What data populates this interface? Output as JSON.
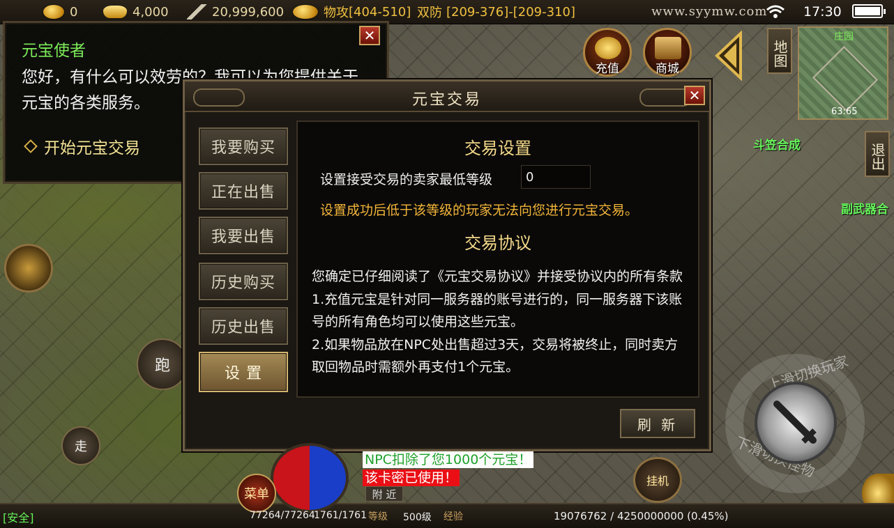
{
  "topbar": {
    "gold": "0",
    "ingot": "4,000",
    "currency3": "20,999,600",
    "attack_label": "物攻",
    "attack_value": "[404-510]",
    "defense_label": "双防",
    "defense_value": "[209-376]-[209-310]",
    "watermark": "www.syymw.com",
    "time": "17:30"
  },
  "npc_dialog": {
    "title": "元宝使者",
    "text": "您好，有什么可以效劳的？我可以为您提供关于元宝的各类服务。",
    "link": "开始元宝交易",
    "close": "✕"
  },
  "right_buttons": {
    "recharge": "充值",
    "shop": "商城",
    "map": "地图",
    "exit": "退出"
  },
  "minimap": {
    "title": "庄园",
    "coords": "63:65"
  },
  "map_labels": {
    "npc1": "斗笠合成",
    "npc2": "副武器合"
  },
  "left_controls": {
    "run": "跑",
    "walk": "走"
  },
  "trade_panel": {
    "title": "元宝交易",
    "close": "✕",
    "tabs": [
      {
        "label": "我要购买"
      },
      {
        "label": "正在出售"
      },
      {
        "label": "我要出售"
      },
      {
        "label": "历史购买"
      },
      {
        "label": "历史出售"
      },
      {
        "label": "设 置"
      }
    ],
    "settings_heading": "交易设置",
    "min_level_label": "设置接受交易的卖家最低等级",
    "min_level_value": "0",
    "warning": "设置成功后低于该等级的玩家无法向您进行元宝交易。",
    "agreement_heading": "交易协议",
    "agreement_text": "您确定已仔细阅读了《元宝交易协议》并接受协议内的所有条款",
    "rule1": "1.充值元宝是针对同一服务器的账号进行的，同一服务器下该账号的所有角色均可以使用这些元宝。",
    "rule2": "2.如果物品放在NPC处出售超过3天，交易将被终止，同时卖方取回物品时需额外再支付1个元宝。",
    "refresh": "刷 新"
  },
  "messages": {
    "npc_deduct": "NPC扣除了您1000个元宝！",
    "card_used": "该卡密已使用！",
    "nearby": "附 近"
  },
  "bottom": {
    "safe": "[安全]",
    "menu": "菜单",
    "hp": "77264/77264",
    "mp": "1761/1761",
    "level_label": "等级",
    "level": "500级",
    "exp_label": "经验",
    "exp": "19076762 / 4250000000 (0.45%)",
    "auto": "挂机"
  },
  "attack_ring": {
    "top": "上滑切换玩家",
    "bottom": "下滑切换怪物"
  }
}
